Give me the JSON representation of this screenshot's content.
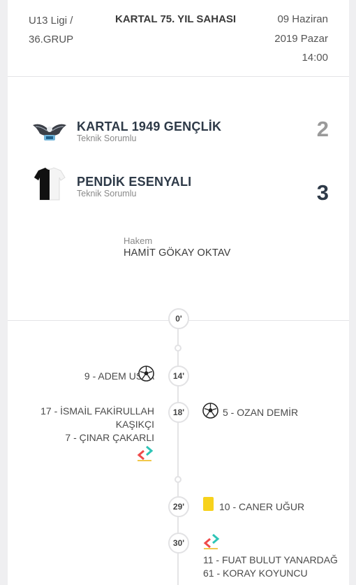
{
  "header": {
    "league_line1": "U13 Ligi /",
    "league_line2": "36.GRUP",
    "venue": "KARTAL 75. YIL SAHASI",
    "date_line1": "09 Haziran",
    "date_line2": "2019 Pazar",
    "time": "14:00"
  },
  "home": {
    "name": "KARTAL 1949 GENÇLİK",
    "subtitle": "Teknik Sorumlu",
    "score": "2",
    "score_color": "#9a9a9a"
  },
  "away": {
    "name": "PENDİK ESENYALI",
    "subtitle": "Teknik Sorumlu",
    "score": "3",
    "score_color": "#2e3a48"
  },
  "referee": {
    "label": "Hakem",
    "name": "HAMİT GÖKAY OKTAV"
  },
  "timeline": {
    "minutes": [
      "0'",
      "14'",
      "18'",
      "29'",
      "30'"
    ],
    "events": {
      "goal_14_left": "9 - ADEM USTA",
      "sub_18_left_line1": "17 - İSMAİL FAKİRULLAH",
      "sub_18_left_line2": "KAŞIKÇI",
      "sub_18_left_line3": "7 - ÇINAR ÇAKARLI",
      "goal_18_right": "5 - OZAN DEMİR",
      "yellow_29_right": "10 - CANER UĞUR",
      "sub_30_right_line1": "11 - FUAT BULUT YANARDAĞ",
      "sub_30_right_line2": "61 - KORAY KOYUNCU"
    }
  },
  "icons": {
    "goal": "soccer-ball-icon",
    "substitution": "substitution-arrows-icon",
    "yellow_card": "yellow-card-icon"
  },
  "colors": {
    "yellow_card": "#f7d21c",
    "sub_in": "#2ec4b6",
    "sub_out": "#ef4a4a"
  }
}
